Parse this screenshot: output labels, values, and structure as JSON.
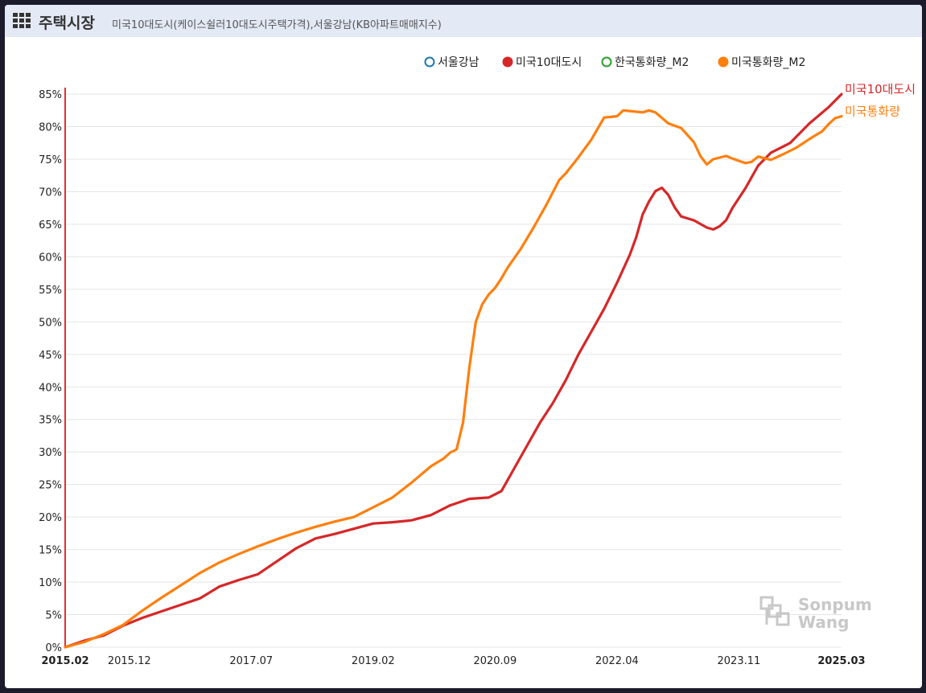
{
  "header": {
    "title": "주택시장",
    "subtitle": "미국10대도시(케이스쉴러10대도시주택가격),서울강남(KB아파트매매지수)",
    "icon": "grid-icon"
  },
  "watermark": {
    "line1": "Sonpum",
    "line2": "Wang"
  },
  "chart_data": {
    "type": "line",
    "ylim": [
      0,
      86
    ],
    "yticks": [
      "0%",
      "5%",
      "10%",
      "15%",
      "20%",
      "25%",
      "30%",
      "35%",
      "40%",
      "45%",
      "50%",
      "55%",
      "60%",
      "65%",
      "70%",
      "75%",
      "80%",
      "85%"
    ],
    "xlim": [
      0,
      121
    ],
    "xticks": [
      {
        "label": "2015.02",
        "x": 0,
        "bold": true
      },
      {
        "label": "2015.12",
        "x": 10,
        "bold": false
      },
      {
        "label": "2017.07",
        "x": 29,
        "bold": false
      },
      {
        "label": "2019.02",
        "x": 48,
        "bold": false
      },
      {
        "label": "2020.09",
        "x": 67,
        "bold": false
      },
      {
        "label": "2022.04",
        "x": 86,
        "bold": false
      },
      {
        "label": "2023.11",
        "x": 105,
        "bold": false
      },
      {
        "label": "2025.03",
        "x": 121,
        "bold": true
      }
    ],
    "legend": [
      {
        "name": "서울강남",
        "color": "#1f77b4",
        "filled": false
      },
      {
        "name": "미국10대도시",
        "color": "#d62728",
        "filled": true
      },
      {
        "name": "한국통화량_M2",
        "color": "#2ca02c",
        "filled": false
      },
      {
        "name": "미국통화량_M2",
        "color": "#ff7f0e",
        "filled": true
      }
    ],
    "series": [
      {
        "name": "미국10대도시",
        "color": "#d62728",
        "end_label": "미국10대도시",
        "points": [
          [
            0,
            0
          ],
          [
            3,
            1
          ],
          [
            6,
            1.8
          ],
          [
            9,
            3.3
          ],
          [
            12,
            4.5
          ],
          [
            15,
            5.5
          ],
          [
            18,
            6.5
          ],
          [
            21,
            7.5
          ],
          [
            24,
            9.3
          ],
          [
            27,
            10.3
          ],
          [
            30,
            11.2
          ],
          [
            33,
            13.2
          ],
          [
            36,
            15.2
          ],
          [
            39,
            16.7
          ],
          [
            42,
            17.4
          ],
          [
            45,
            18.2
          ],
          [
            48,
            19
          ],
          [
            51,
            19.2
          ],
          [
            54,
            19.5
          ],
          [
            57,
            20.3
          ],
          [
            60,
            21.8
          ],
          [
            63,
            22.8
          ],
          [
            66,
            23
          ],
          [
            68,
            24
          ],
          [
            70,
            27.5
          ],
          [
            72,
            31
          ],
          [
            74,
            34.5
          ],
          [
            76,
            37.5
          ],
          [
            78,
            41
          ],
          [
            80,
            45
          ],
          [
            82,
            48.5
          ],
          [
            84,
            52
          ],
          [
            86,
            56
          ],
          [
            88,
            60.3
          ],
          [
            89,
            63
          ],
          [
            90,
            66.5
          ],
          [
            91,
            68.5
          ],
          [
            92,
            70.1
          ],
          [
            93,
            70.6
          ],
          [
            94,
            69.5
          ],
          [
            95,
            67.6
          ],
          [
            96,
            66.2
          ],
          [
            98,
            65.6
          ],
          [
            100,
            64.5
          ],
          [
            101,
            64.2
          ],
          [
            102,
            64.7
          ],
          [
            103,
            65.6
          ],
          [
            104,
            67.5
          ],
          [
            106,
            70.5
          ],
          [
            108,
            74
          ],
          [
            110,
            76
          ],
          [
            113,
            77.5
          ],
          [
            116,
            80.5
          ],
          [
            119,
            83
          ],
          [
            121,
            85
          ]
        ]
      },
      {
        "name": "미국통화량_M2",
        "color": "#ff7f0e",
        "end_label": "미국통화량",
        "points": [
          [
            0,
            0
          ],
          [
            3,
            0.8
          ],
          [
            6,
            2
          ],
          [
            9,
            3.4
          ],
          [
            12,
            5.6
          ],
          [
            15,
            7.6
          ],
          [
            18,
            9.5
          ],
          [
            21,
            11.4
          ],
          [
            24,
            13
          ],
          [
            27,
            14.3
          ],
          [
            30,
            15.5
          ],
          [
            33,
            16.6
          ],
          [
            36,
            17.6
          ],
          [
            39,
            18.5
          ],
          [
            42,
            19.3
          ],
          [
            45,
            20
          ],
          [
            48,
            21.5
          ],
          [
            51,
            23
          ],
          [
            54,
            25.3
          ],
          [
            57,
            27.8
          ],
          [
            59,
            29
          ],
          [
            60,
            29.9
          ],
          [
            61,
            30.4
          ],
          [
            62,
            34.5
          ],
          [
            63,
            43
          ],
          [
            64,
            50
          ],
          [
            65,
            52.7
          ],
          [
            66,
            54.2
          ],
          [
            67,
            55.2
          ],
          [
            68,
            56.7
          ],
          [
            69,
            58.4
          ],
          [
            71,
            61.2
          ],
          [
            73,
            64.5
          ],
          [
            75,
            68
          ],
          [
            77,
            71.8
          ],
          [
            78,
            72.8
          ],
          [
            80,
            75.3
          ],
          [
            82,
            78
          ],
          [
            84,
            81.4
          ],
          [
            86,
            81.6
          ],
          [
            87,
            82.5
          ],
          [
            88,
            82.4
          ],
          [
            90,
            82.2
          ],
          [
            91,
            82.5
          ],
          [
            92,
            82.2
          ],
          [
            94,
            80.5
          ],
          [
            96,
            79.8
          ],
          [
            98,
            77.6
          ],
          [
            99,
            75.5
          ],
          [
            100,
            74.2
          ],
          [
            101,
            75
          ],
          [
            103,
            75.5
          ],
          [
            104,
            75.1
          ],
          [
            106,
            74.4
          ],
          [
            107,
            74.6
          ],
          [
            108,
            75.4
          ],
          [
            110,
            74.9
          ],
          [
            112,
            75.8
          ],
          [
            114,
            76.8
          ],
          [
            116,
            78.1
          ],
          [
            118,
            79.3
          ],
          [
            119,
            80.4
          ],
          [
            120,
            81.3
          ],
          [
            121,
            81.6
          ]
        ]
      }
    ]
  }
}
